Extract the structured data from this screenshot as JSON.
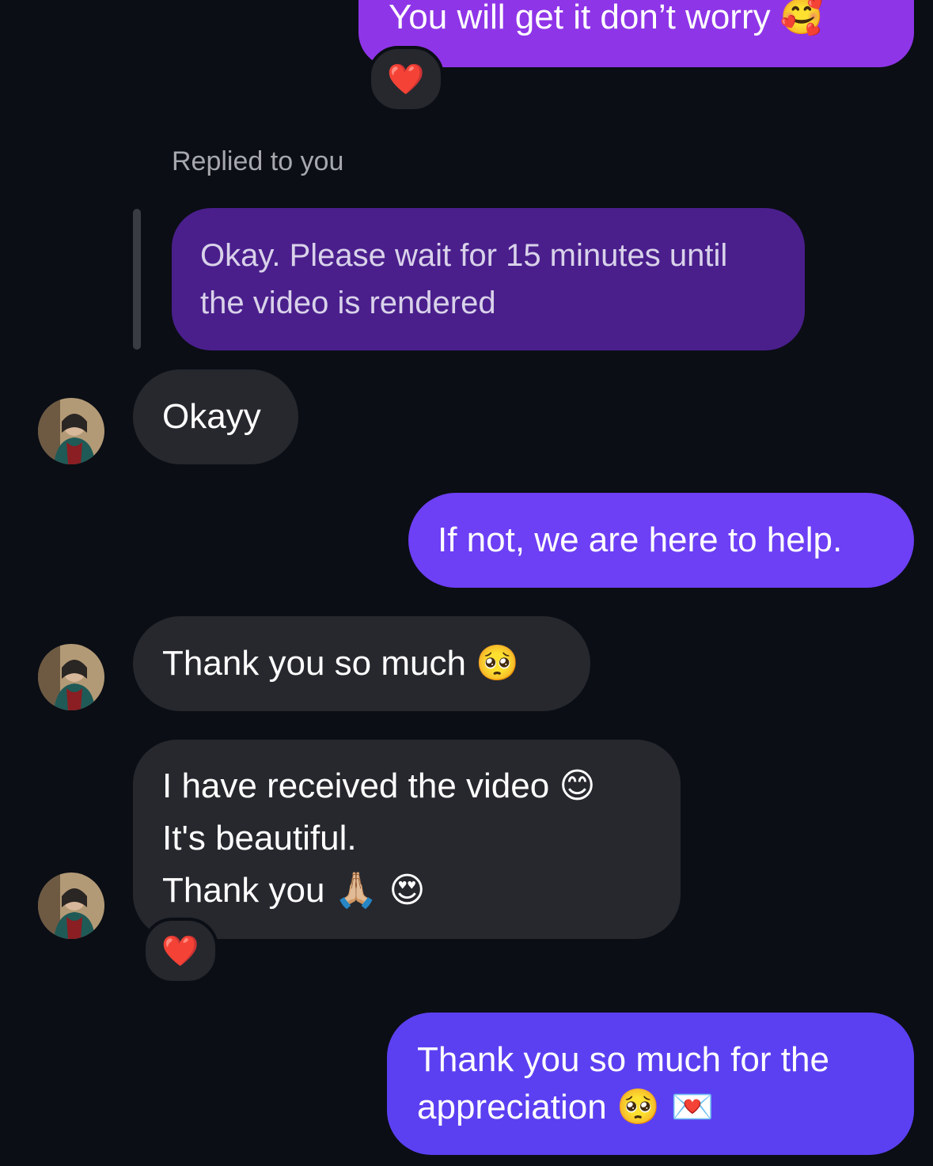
{
  "conversation": {
    "messages": [
      {
        "id": "m1",
        "direction": "sent",
        "text": "You will get it don’t worry",
        "emoji": "🥰",
        "reaction": "❤️"
      },
      {
        "id": "m2",
        "direction": "sent",
        "reply_label": "Replied to you",
        "text_line1": "Okay. Please wait for 15 minutes until",
        "text_line2": "the video is rendered"
      },
      {
        "id": "m3",
        "direction": "received",
        "text": "Okayy"
      },
      {
        "id": "m4",
        "direction": "sent",
        "text": "If not, we are here to help."
      },
      {
        "id": "m5",
        "direction": "received",
        "text": "Thank you so much",
        "emoji": "🥺"
      },
      {
        "id": "m6",
        "direction": "received",
        "line1": "I have received the video",
        "line1_emoji": "😊",
        "line2": "It's beautiful.",
        "line3": "Thank you",
        "line3_emoji": "🙏🏼 😍",
        "reaction": "❤️"
      },
      {
        "id": "m7",
        "direction": "sent",
        "line1": "Thank you so much for the",
        "line2": "appreciation",
        "line2_emoji": "🥺 💌"
      }
    ]
  },
  "colors": {
    "background": "#0b0e15",
    "received_bubble": "#26282e",
    "sent_purple": "#8f35e8",
    "sent_violet": "#6d3ff5",
    "sent_indigo": "#5b40f2",
    "reply_bubble": "#4a1f8c",
    "reaction_heart": "#ff2a3d"
  }
}
